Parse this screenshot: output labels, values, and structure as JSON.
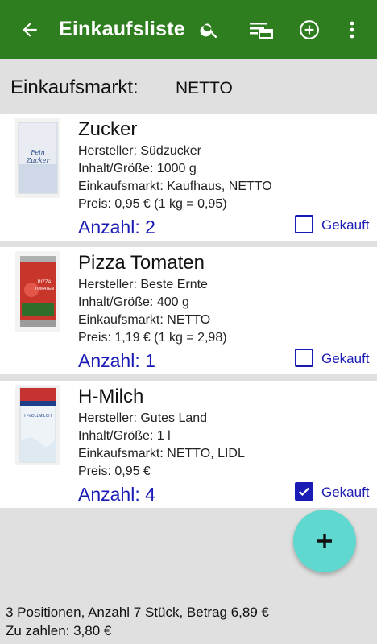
{
  "appbar": {
    "title": "Einkaufsliste",
    "back_icon": "arrow-back-icon",
    "actions": [
      "search-icon",
      "filter-list-icon",
      "add-circle-icon",
      "more-vert-icon"
    ],
    "color": "#2e7d1e"
  },
  "market": {
    "label": "Einkaufsmarkt:",
    "value": "NETTO"
  },
  "items": [
    {
      "name": "Zucker",
      "hersteller": "Hersteller: Südzucker",
      "inhalt": "Inhalt/Größe: 1000 g",
      "einkaufsmarkt": "Einkaufsmarkt: Kaufhaus, NETTO",
      "preis": "Preis: 0,95 € (1 kg = 0,95)",
      "anzahl": "Anzahl: 2",
      "gekauft_label": "Gekauft",
      "gekauft": false,
      "image": "sugar-package-image"
    },
    {
      "name": "Pizza Tomaten",
      "hersteller": "Hersteller: Beste Ernte",
      "inhalt": "Inhalt/Größe: 400 g",
      "einkaufsmarkt": "Einkaufsmarkt: NETTO",
      "preis": "Preis: 1,19 € (1 kg = 2,98)",
      "anzahl": "Anzahl: 1",
      "gekauft_label": "Gekauft",
      "gekauft": false,
      "image": "tomato-can-image"
    },
    {
      "name": "H-Milch",
      "hersteller": "Hersteller: Gutes Land",
      "inhalt": "Inhalt/Größe: 1 l",
      "einkaufsmarkt": "Einkaufsmarkt: NETTO, LIDL",
      "preis": "Preis: 0,95 €",
      "anzahl": "Anzahl: 4",
      "gekauft_label": "Gekauft",
      "gekauft": true,
      "image": "milk-carton-image"
    }
  ],
  "fab": {
    "icon": "plus-icon",
    "color": "#5fd9cf"
  },
  "footer": {
    "summary": "3 Positionen, Anzahl 7 Stück, Betrag 6,89 €",
    "to_pay": "Zu zahlen: 3,80 €"
  }
}
